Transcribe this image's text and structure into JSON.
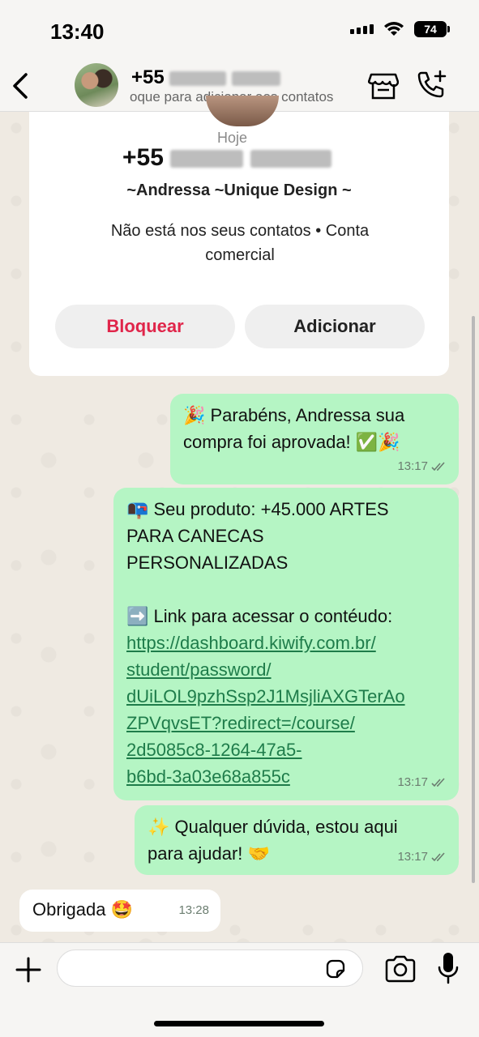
{
  "status_bar": {
    "time": "13:40",
    "battery": "74"
  },
  "header": {
    "name": "+55",
    "subtitle": "oque para adicionar aos contatos"
  },
  "contact_card": {
    "date": "Hoje",
    "number": "+55",
    "business_name": "~Andressa ~Unique Design ~",
    "info": "Não está nos seus contatos • Conta comercial",
    "block_label": "Bloquear",
    "add_label": "Adicionar"
  },
  "messages": [
    {
      "direction": "out",
      "text_lines": [
        "🎉 Parabéns, Andressa sua",
        "compra foi aprovada! ✅🎉"
      ],
      "time": "13:17",
      "status": "read"
    },
    {
      "direction": "out",
      "intro_lines": [
        "📭 Seu produto: +45.000 ARTES",
        "PARA CANECAS",
        "PERSONALIZADAS"
      ],
      "link_intro": "➡️ Link para acessar o contéudo:",
      "link_lines": [
        "https://dashboard.kiwify.com.br/",
        "student/password/",
        "dUiLOL9pzhSsp2J1MsjliAXGTerAo",
        "ZPVqvsET?redirect=/course/",
        "2d5085c8-1264-47a5-",
        "b6bd-3a03e68a855c"
      ],
      "time": "13:17",
      "status": "read"
    },
    {
      "direction": "out",
      "text_lines": [
        "✨ Qualquer dúvida, estou aqui",
        "para ajudar! 🤝"
      ],
      "time": "13:17",
      "status": "read"
    },
    {
      "direction": "in",
      "text": "Obrigada 🤩",
      "time": "13:28"
    }
  ],
  "composer": {
    "placeholder": ""
  },
  "colors": {
    "outgoing_bubble": "#b5f5c4",
    "block_red": "#e0254a",
    "link_green": "#1e7c4a"
  }
}
